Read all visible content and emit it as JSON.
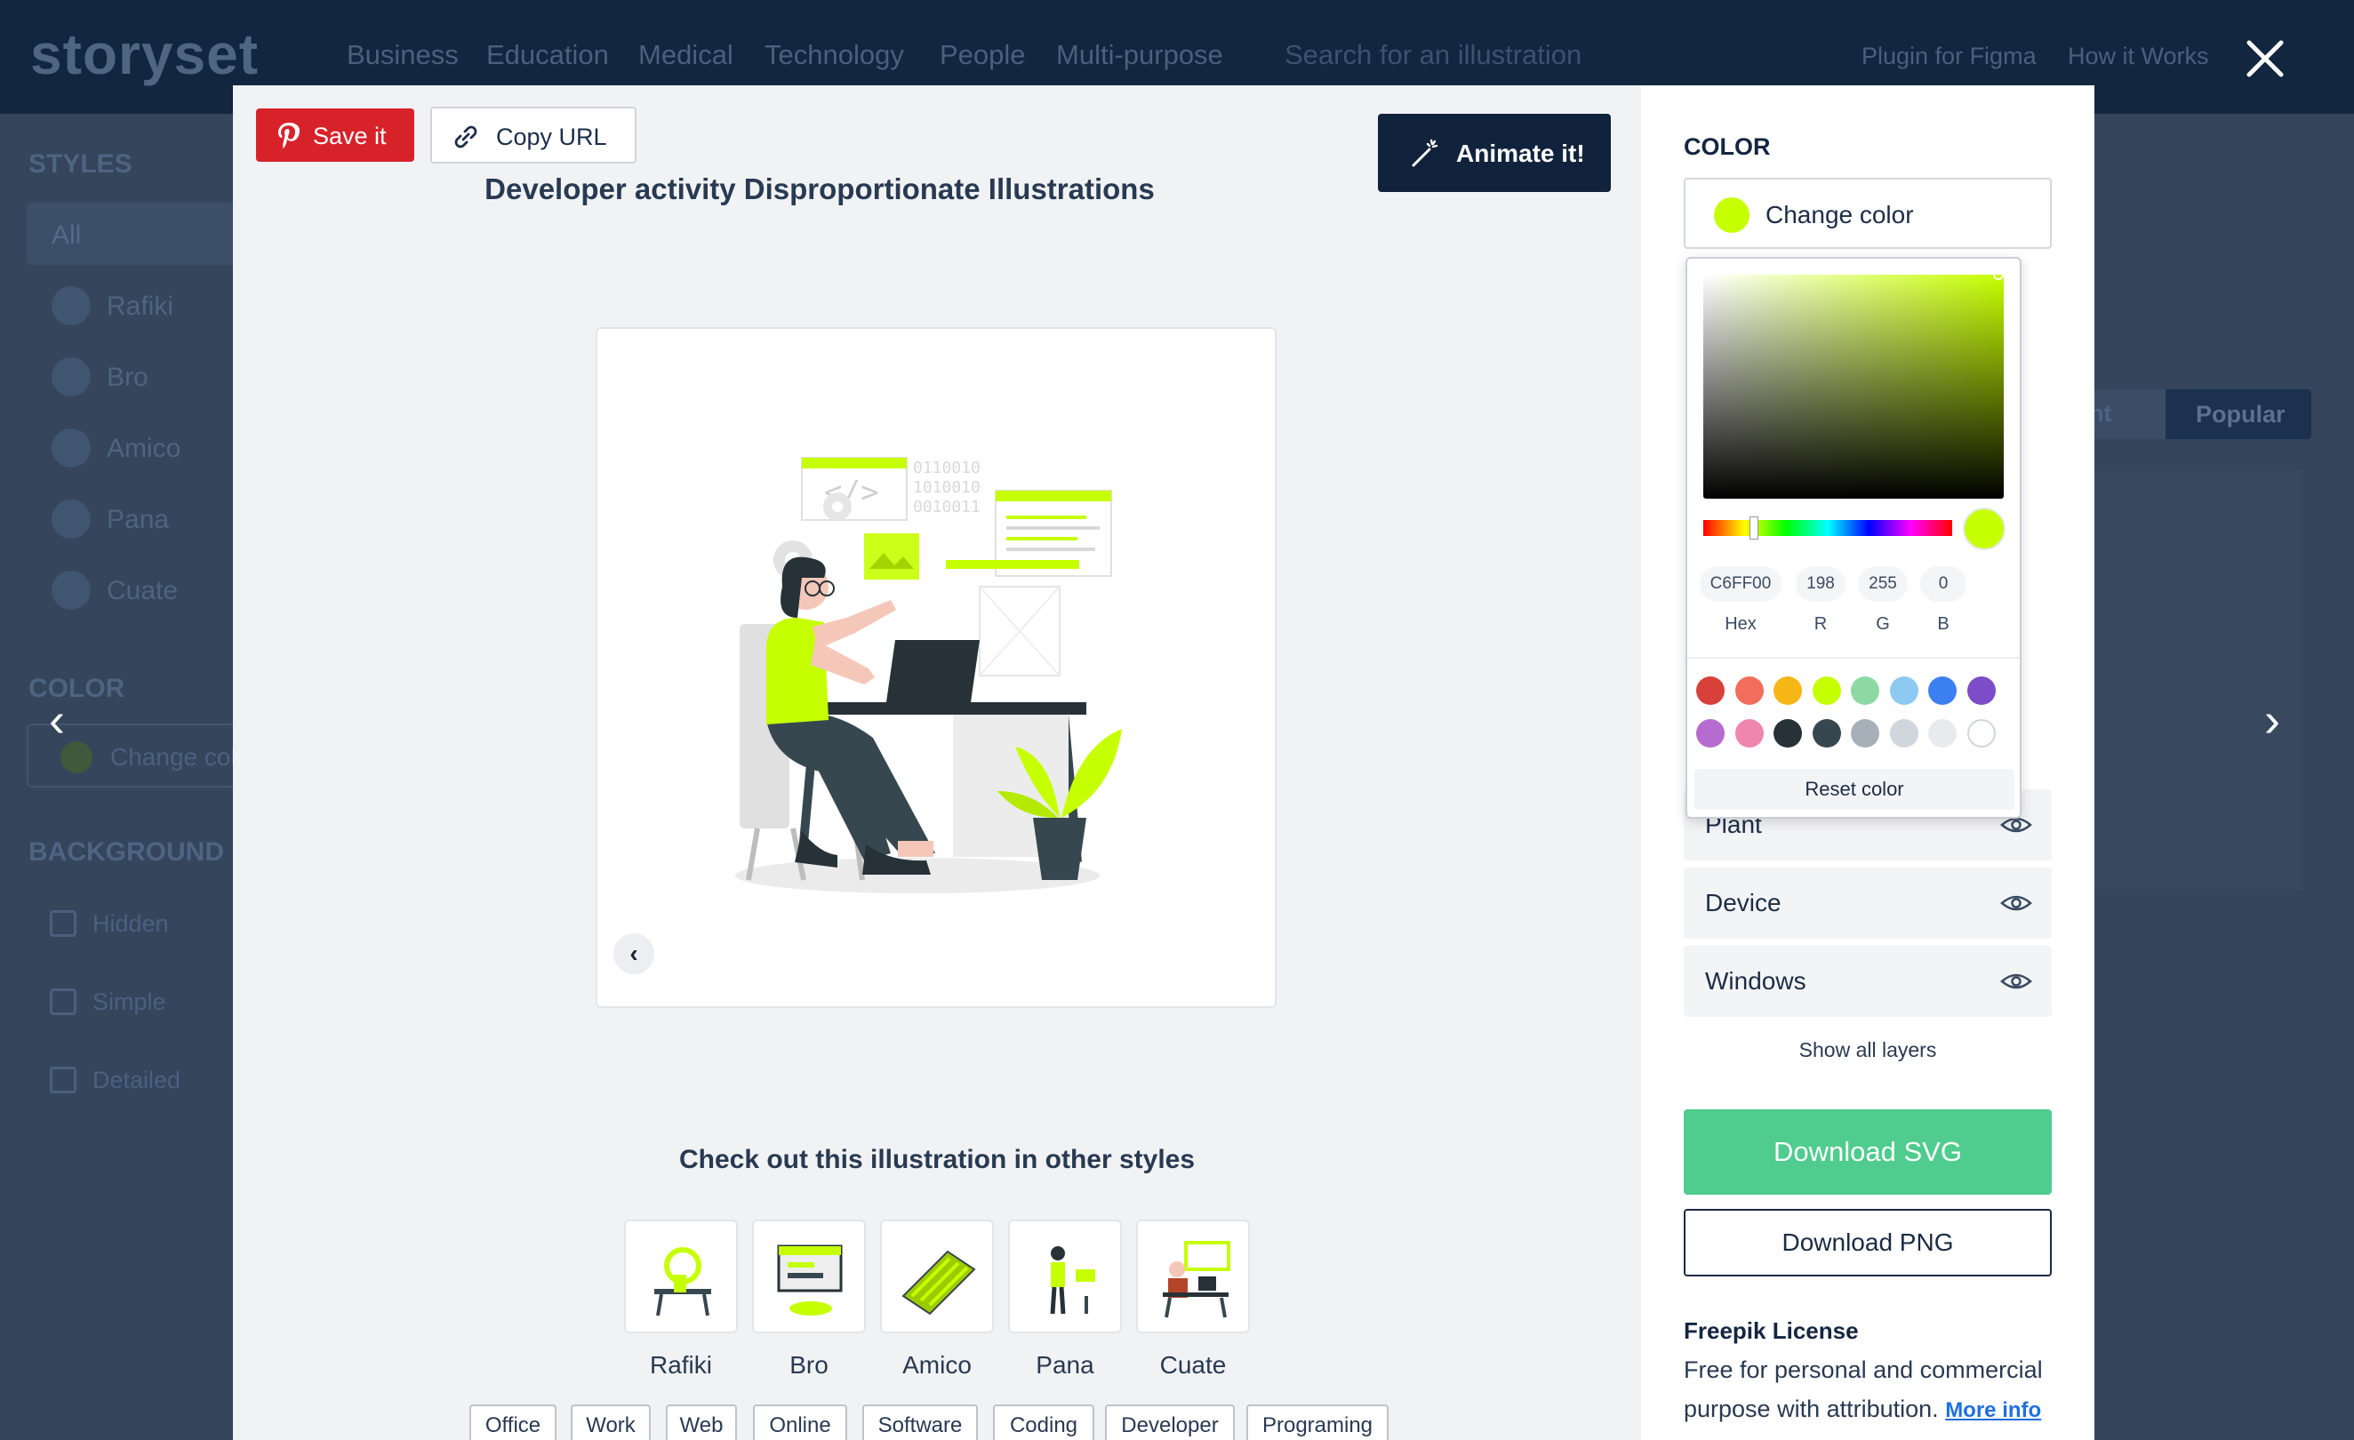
{
  "background_page": {
    "logo": "storyset",
    "nav": [
      "Business",
      "Education",
      "Medical",
      "Technology",
      "People",
      "Multi-purpose"
    ],
    "search_placeholder": "Search for an illustration",
    "right_links": [
      "Plugin for Figma",
      "How it Works"
    ],
    "sidebar": {
      "styles_heading": "STYLES",
      "styles": [
        "All",
        "Rafiki",
        "Bro",
        "Amico",
        "Pana",
        "Cuate"
      ],
      "color_heading": "COLOR",
      "change_color": "Change col",
      "background_heading": "BACKGROUND",
      "backgrounds": [
        "Hidden",
        "Simple",
        "Detailed"
      ]
    },
    "tabs": [
      "ent",
      "Popular"
    ]
  },
  "modal": {
    "save_label": "Save it",
    "copy_label": "Copy URL",
    "animate_label": "Animate it!",
    "title": "Developer activity Disproportionate Illustrations",
    "other_styles_title": "Check out this illustration in other styles",
    "styles": [
      {
        "label": "Rafiki",
        "icon": "rafiki-thumbnail"
      },
      {
        "label": "Bro",
        "icon": "bro-thumbnail"
      },
      {
        "label": "Amico",
        "icon": "amico-thumbnail"
      },
      {
        "label": "Pana",
        "icon": "pana-thumbnail"
      },
      {
        "label": "Cuate",
        "icon": "cuate-thumbnail"
      }
    ],
    "tags": [
      "Office",
      "Work",
      "Web",
      "Online",
      "Software",
      "Coding",
      "Developer",
      "Programing"
    ]
  },
  "panel": {
    "color_heading": "COLOR",
    "change_color_label": "Change color",
    "current_color": "#C6FF00",
    "picker": {
      "hex": "C6FF00",
      "r": "198",
      "g": "255",
      "b": "0",
      "hex_label": "Hex",
      "r_label": "R",
      "g_label": "G",
      "b_label": "B",
      "presets": [
        "#d7413a",
        "#f26d5b",
        "#f6b716",
        "#c6ff00",
        "#8cd9a4",
        "#8ec9f2",
        "#3b7ff2",
        "#7d4cc9",
        "#b66bd1",
        "#ef86ad",
        "#263238",
        "#37474f",
        "#a7b0b9",
        "#cfd6dc",
        "#e8ebee",
        "#ffffff"
      ],
      "reset_label": "Reset color"
    },
    "layers": [
      "Plant",
      "Device",
      "Windows"
    ],
    "show_all_layers": "Show all layers",
    "download_svg": "Download SVG",
    "download_png": "Download PNG",
    "license_heading": "Freepik License",
    "license_text_1": "Free for personal and commercial",
    "license_text_2": "purpose with attribution.",
    "more_info": "More info"
  }
}
